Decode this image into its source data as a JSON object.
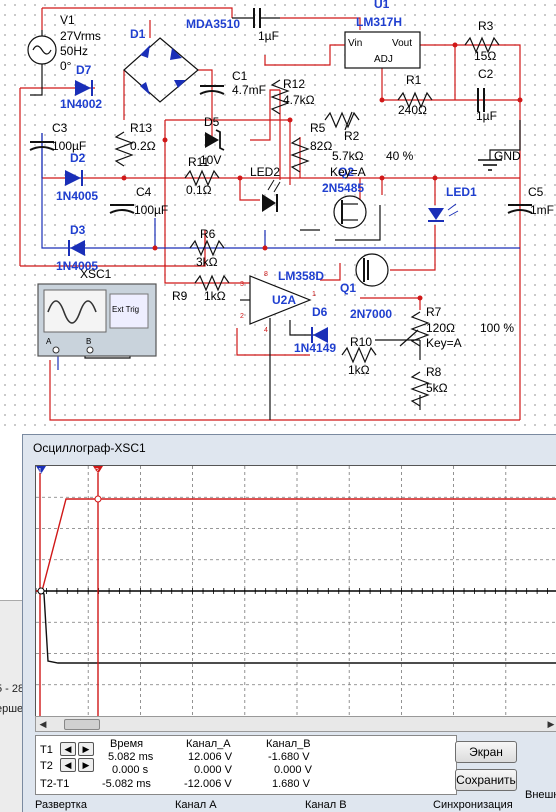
{
  "schematic": {
    "labels": {
      "v1": "V1",
      "v1_amp": "27Vrms",
      "v1_freq": "50Hz",
      "v1_phase": "0°",
      "d1": "D1",
      "mda": "MDA3510",
      "cap_top": "1µF",
      "u1": "U1",
      "lm317": "LM317H",
      "vin": "Vin",
      "vout": "Vout",
      "adj": "ADJ",
      "r3": "R3",
      "r3v": "15Ω",
      "r1": "R1",
      "r1v": "240Ω",
      "c2": "C2",
      "c2v": "1µF",
      "d7": "D7",
      "d7v": "1N4002",
      "c1": "C1",
      "c1v": "4.7mF",
      "r12": "R12",
      "r12v": "4.7kΩ",
      "c3": "C3",
      "c3v": "100µF",
      "r13": "R13",
      "r13v": "0.2Ω",
      "d5": "D5",
      "d5v": "10V",
      "r5": "R5",
      "r5v": "82Ω",
      "r2": "R2",
      "r2v": "5.7kΩ",
      "r2p": "40 %",
      "gnd": "GND",
      "d2": "D2",
      "d2v": "1N4005",
      "r11": "R11",
      "r11v": "0.1Ω",
      "led2": "LED2",
      "q2": "Q2",
      "keya": "Key=A",
      "q2v": "2N5485",
      "led1": "LED1",
      "c4": "C4",
      "c4v": "100µF",
      "c5": "C5",
      "c5v": "1mF",
      "d3": "D3",
      "d3v": "1N4005",
      "r6": "R6",
      "r6v": "3kΩ",
      "xsc1": "XSC1",
      "lm358": "LM358D",
      "q1": "Q1",
      "r9": "R9",
      "r9v": "1kΩ",
      "u2a": "U2A",
      "d6": "D6",
      "q1v": "2N7000",
      "r7": "R7",
      "r7v": "120Ω",
      "r7p": "100 %",
      "keya2": "Key=A",
      "d6v": "1N4149",
      "r10": "R10",
      "r10v": "1kΩ",
      "r8": "R8",
      "r8v": "5kΩ",
      "xsc_ext": "Ext Trig",
      "xsc_a": "A",
      "xsc_b": "B",
      "p3": "3",
      "p2": "2",
      "p8": "8",
      "p4": "4",
      "p1": "1"
    }
  },
  "background_window": {
    "line1": "5 - 28",
    "line2": "ерше"
  },
  "oscilloscope": {
    "title": "Осциллограф-XSC1",
    "screen": {
      "cursor1_marker": "1",
      "cursor2_marker": "2",
      "channel_a_color": "#d01818",
      "channel_b_color": "#101010",
      "cursor_color": "#d01818",
      "grid_color": "#777777"
    },
    "readout": {
      "headers": {
        "time": "Время",
        "ch_a": "Канал_A",
        "ch_b": "Канал_B"
      },
      "rows": [
        {
          "label": "T1",
          "time": "5.082 ms",
          "ch_a": "12.006 V",
          "ch_b": "-1.680 V"
        },
        {
          "label": "T2",
          "time": "0.000 s",
          "ch_a": "0.000 V",
          "ch_b": "0.000 V"
        },
        {
          "label": "T2-T1",
          "time": "-5.082 ms",
          "ch_a": "-12.006 V",
          "ch_b": "1.680 V"
        }
      ]
    },
    "buttons": {
      "screen": "Экран",
      "save": "Сохранить",
      "external": "Внешн"
    },
    "sections": {
      "timebase": "Развертка",
      "ch_a": "Канал A",
      "ch_b": "Канал B",
      "trigger": "Синхронизация"
    }
  }
}
